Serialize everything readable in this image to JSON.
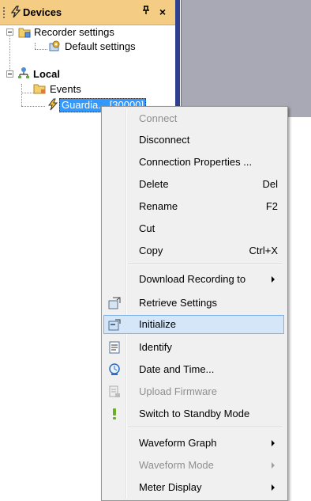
{
  "panel": {
    "title": "Devices",
    "pin_glyph": "Ш",
    "close_glyph": "×"
  },
  "tree": {
    "recorder_settings": "Recorder settings",
    "default_settings": "Default settings",
    "local": "Local",
    "events": "Events",
    "selected_device": "Guardia... [30000]"
  },
  "menu": {
    "items": [
      {
        "label": "Connect",
        "disabled": true
      },
      {
        "label": "Disconnect"
      },
      {
        "label": "Connection Properties ..."
      },
      {
        "label": "Delete",
        "shortcut": "Del"
      },
      {
        "label": "Rename",
        "shortcut": "F2"
      },
      {
        "label": "Cut"
      },
      {
        "label": "Copy",
        "shortcut": "Ctrl+X"
      },
      {
        "label": "Download Recording to",
        "submenu": true
      },
      {
        "label": "Retrieve Settings",
        "icon": "retrieve-settings-icon"
      },
      {
        "label": "Initialize",
        "icon": "initialize-icon",
        "highlighted": true
      },
      {
        "label": "Identify",
        "icon": "identify-icon"
      },
      {
        "label": "Date and Time...",
        "icon": "clock-icon"
      },
      {
        "label": "Upload Firmware",
        "icon": "upload-firmware-icon",
        "disabled": true
      },
      {
        "label": "Switch to Standby Mode",
        "icon": "exclamation-icon"
      },
      {
        "label": "Waveform Graph",
        "submenu": true
      },
      {
        "label": "Waveform Mode",
        "submenu": true,
        "disabled": true
      },
      {
        "label": "Meter Display",
        "submenu": true
      }
    ]
  },
  "colors": {
    "title_bar": "#f5cc84",
    "workspace": "#a9a9b5",
    "selection": "#3399ff",
    "menu_highlight": "#d4e6f8"
  }
}
